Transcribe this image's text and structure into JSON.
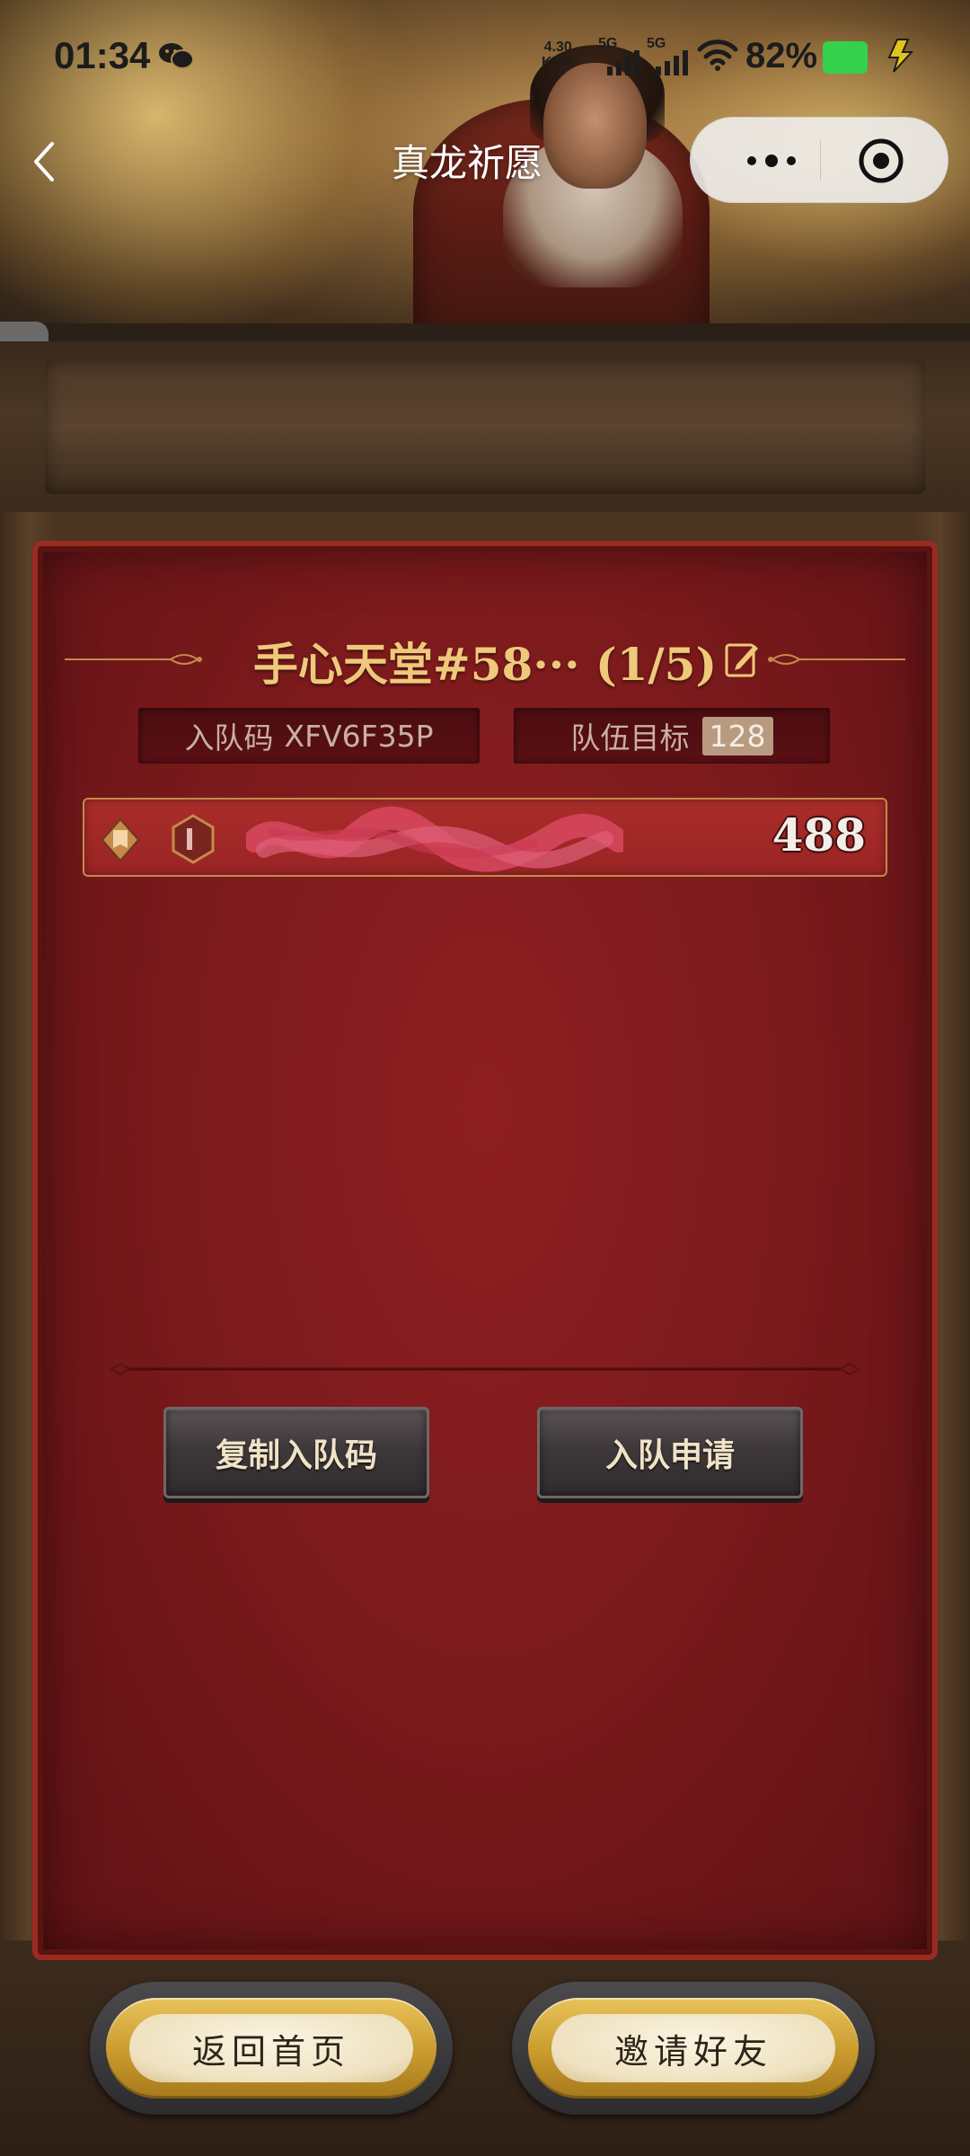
{
  "status_bar": {
    "time": "01:34",
    "net_speed_value": "4.30",
    "net_speed_unit": "KB/s",
    "signal_1_label": "5G",
    "signal_2_label": "5G",
    "battery_pct": "82%",
    "battery_color": "#35d14d",
    "icons": [
      "wechat-icon",
      "wifi-icon",
      "battery-icon",
      "charging-icon"
    ]
  },
  "nav": {
    "title": "真龙祈愿",
    "back_icon": "chevron-left-icon",
    "more_icon": "more-dots-icon",
    "close_icon": "target-circle-icon"
  },
  "side_tab": {
    "icon": "chevron-right-icon"
  },
  "team": {
    "title": "手心天堂#58··· (1/5)",
    "edit_icon": "edit-icon",
    "code_label": "入队码",
    "code_value": "XFV6F35P",
    "goal_label": "队伍目标",
    "goal_value": "128"
  },
  "members": [
    {
      "name": "",
      "score": "488"
    }
  ],
  "actions": {
    "copy_label": "复制入队码",
    "apply_label": "入队申请"
  },
  "bottom": {
    "home_label": "返回首页",
    "invite_label": "邀请好友"
  },
  "colors": {
    "title_gold": "#efc97a",
    "panel_red": "#8e1f22",
    "button_gold": "#e8c35a"
  }
}
